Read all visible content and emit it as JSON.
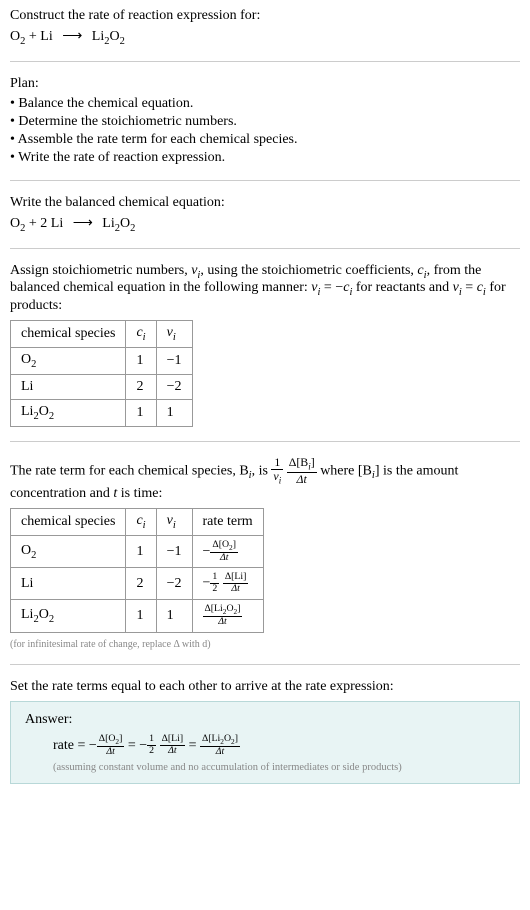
{
  "intro": {
    "prompt": "Construct the rate of reaction expression for:",
    "equation_lhs1": "O",
    "equation_lhs1_sub": "2",
    "equation_plus1": " + Li ",
    "equation_arrow": "⟶",
    "equation_rhs": " Li",
    "equation_rhs_sub1": "2",
    "equation_rhs_mid": "O",
    "equation_rhs_sub2": "2"
  },
  "plan": {
    "heading": "Plan:",
    "items": [
      "• Balance the chemical equation.",
      "• Determine the stoichiometric numbers.",
      "• Assemble the rate term for each chemical species.",
      "• Write the rate of reaction expression."
    ]
  },
  "balanced": {
    "heading": "Write the balanced chemical equation:",
    "lhs1": "O",
    "lhs1_sub": "2",
    "plus": " + 2 Li ",
    "arrow": "⟶",
    "rhs": " Li",
    "rhs_sub1": "2",
    "rhs_mid": "O",
    "rhs_sub2": "2"
  },
  "assign": {
    "text1": "Assign stoichiometric numbers, ",
    "nu": "ν",
    "sub_i": "i",
    "text2": ", using the stoichiometric coefficients, ",
    "c": "c",
    "text3": ", from the balanced chemical equation in the following manner: ",
    "eq1_lhs": "ν",
    "eq1_eq": " = −",
    "eq1_rhs": "c",
    "text4": " for reactants and ",
    "eq2_lhs": "ν",
    "eq2_eq": " = ",
    "eq2_rhs": "c",
    "text5": " for products:"
  },
  "table1": {
    "headers": {
      "species": "chemical species",
      "ci": "c",
      "ci_sub": "i",
      "nui": "ν",
      "nui_sub": "i"
    },
    "rows": [
      {
        "species_base": "O",
        "species_sub": "2",
        "ci": "1",
        "nui": "−1"
      },
      {
        "species_base": "Li",
        "species_sub": "",
        "ci": "2",
        "nui": "−2"
      },
      {
        "species_base": "Li",
        "species_sub": "2",
        "species_base2": "O",
        "species_sub2": "2",
        "ci": "1",
        "nui": "1"
      }
    ]
  },
  "rateterm": {
    "text1": "The rate term for each chemical species, B",
    "sub_i": "i",
    "text2": ", is ",
    "frac1_num": "1",
    "frac1_den_base": "ν",
    "frac1_den_sub": "i",
    "frac2_num": "Δ[B",
    "frac2_num_sub": "i",
    "frac2_num_end": "]",
    "frac2_den": "Δt",
    "text3": " where [B",
    "text4": "] is the amount concentration and ",
    "t": "t",
    "text5": " is time:"
  },
  "table2": {
    "headers": {
      "species": "chemical species",
      "ci": "c",
      "ci_sub": "i",
      "nui": "ν",
      "nui_sub": "i",
      "rate": "rate term"
    },
    "rows": [
      {
        "species_base": "O",
        "species_sub": "2",
        "ci": "1",
        "nui": "−1",
        "rate_prefix": "−",
        "rate_num": "Δ[O",
        "rate_num_sub": "2",
        "rate_num_end": "]",
        "rate_den": "Δt"
      },
      {
        "species_base": "Li",
        "species_sub": "",
        "ci": "2",
        "nui": "−2",
        "rate_prefix": "−",
        "rate_frac1_num": "1",
        "rate_frac1_den": "2",
        "rate_num": "Δ[Li]",
        "rate_den": "Δt"
      },
      {
        "species_base": "Li",
        "species_sub": "2",
        "species_base2": "O",
        "species_sub2": "2",
        "ci": "1",
        "nui": "1",
        "rate_prefix": "",
        "rate_num": "Δ[Li",
        "rate_num_sub": "2",
        "rate_num_mid": "O",
        "rate_num_sub2": "2",
        "rate_num_end": "]",
        "rate_den": "Δt"
      }
    ],
    "note": "(for infinitesimal rate of change, replace Δ with d)"
  },
  "final": {
    "heading": "Set the rate terms equal to each other to arrive at the rate expression:"
  },
  "answer": {
    "label": "Answer:",
    "rate_label": "rate = −",
    "t1_num": "Δ[O",
    "t1_num_sub": "2",
    "t1_num_end": "]",
    "t1_den": "Δt",
    "eq1": " = −",
    "half_num": "1",
    "half_den": "2",
    "t2_num": "Δ[Li]",
    "t2_den": "Δt",
    "eq2": " = ",
    "t3_num": "Δ[Li",
    "t3_num_sub": "2",
    "t3_num_mid": "O",
    "t3_num_sub2": "2",
    "t3_num_end": "]",
    "t3_den": "Δt",
    "note": "(assuming constant volume and no accumulation of intermediates or side products)"
  }
}
